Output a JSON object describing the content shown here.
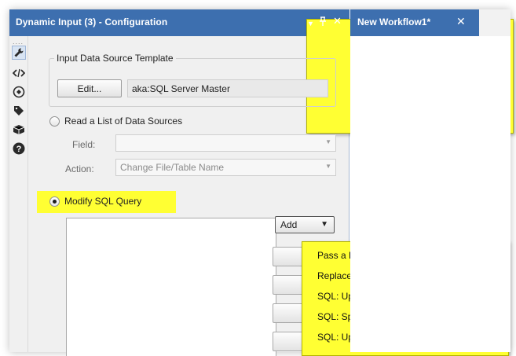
{
  "config_panel": {
    "title": "Dynamic Input (3) - Configuration",
    "controls": {
      "menu": "▼",
      "pin": "ᵾ",
      "close": "✕"
    }
  },
  "rail": {
    "dots": "....",
    "icons": [
      "wrench-icon",
      "code-icon",
      "annotation-icon",
      "tag-icon",
      "cube-icon",
      "help-icon"
    ]
  },
  "input_template": {
    "legend": "Input Data Source Template",
    "edit_label": "Edit...",
    "value": "aka:SQL Server Master"
  },
  "read_list": {
    "label": "Read a List of Data Sources",
    "selected": false,
    "field_label": "Field:",
    "field_value": "",
    "action_label": "Action:",
    "action_value": "Change File/Table Name"
  },
  "modify_sql": {
    "label": "Modify SQL Query",
    "selected": true,
    "add_label": "Add",
    "highlight_color": "#ffff33"
  },
  "add_menu": {
    "items": [
      "Pass a Field to the Output",
      "Replace a Specific String",
      "SQL: Update WHERE Clause",
      "SQL: Spatial Filter",
      "SQL: Update Stored Procedure"
    ]
  },
  "workflow": {
    "tab_label": "New Workflow1*",
    "close": "✕",
    "accent": "#3d6faf"
  }
}
